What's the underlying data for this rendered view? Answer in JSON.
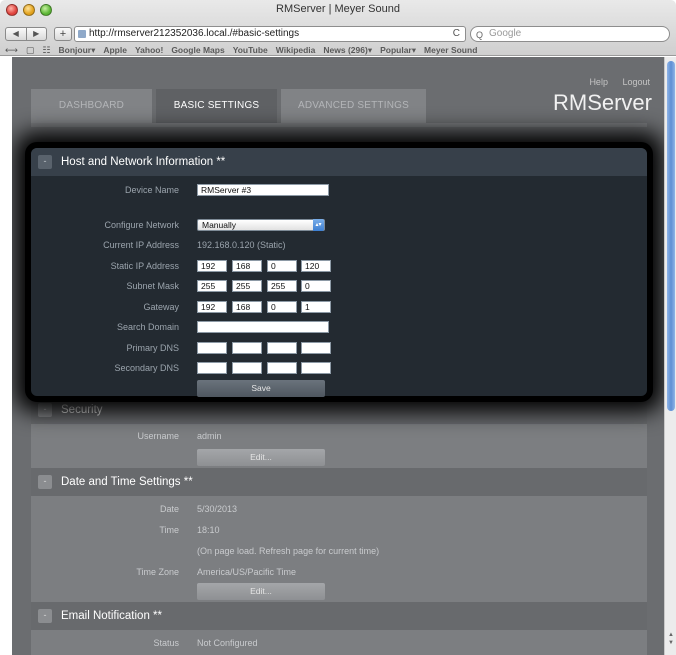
{
  "browser": {
    "window_title": "RMServer | Meyer Sound",
    "nav_back": "◀",
    "nav_forward": "▶",
    "add_label": "+",
    "url": "http://rmserver212352036.local./#basic-settings",
    "reload": "C",
    "search_placeholder": "Google",
    "bookmarks": [
      "Bonjour▾",
      "Apple",
      "Yahoo!",
      "Google Maps",
      "YouTube",
      "Wikipedia",
      "News (296)▾",
      "Popular▾",
      "Meyer Sound"
    ]
  },
  "header": {
    "help": "Help",
    "logout": "Logout",
    "brand": "RMServer"
  },
  "tabs": [
    "DASHBOARD",
    "BASIC SETTINGS",
    "ADVANCED SETTINGS"
  ],
  "network": {
    "title": "Host and Network Information **",
    "collapse": "-",
    "device_name_label": "Device Name",
    "device_name": "RMServer #3",
    "configure_label": "Configure Network",
    "configure_value": "Manually",
    "current_ip_label": "Current IP Address",
    "current_ip": "192.168.0.120 (Static)",
    "static_ip_label": "Static IP Address",
    "static_ip": [
      "192",
      "168",
      "0",
      "120"
    ],
    "subnet_label": "Subnet Mask",
    "subnet": [
      "255",
      "255",
      "255",
      "0"
    ],
    "gateway_label": "Gateway",
    "gateway": [
      "192",
      "168",
      "0",
      "1"
    ],
    "search_domain_label": "Search Domain",
    "search_domain": "",
    "primary_dns_label": "Primary DNS",
    "secondary_dns_label": "Secondary DNS",
    "save": "Save"
  },
  "security": {
    "title": "Security",
    "collapse": "-",
    "username_label": "Username",
    "username": "admin",
    "edit": "Edit..."
  },
  "datetime": {
    "title": "Date and Time Settings **",
    "collapse": "-",
    "date_label": "Date",
    "date": "5/30/2013",
    "time_label": "Time",
    "time": "18:10",
    "note": "(On page load. Refresh page for current time)",
    "tz_label": "Time Zone",
    "tz": "America/US/Pacific Time",
    "edit": "Edit..."
  },
  "email": {
    "title": "Email Notification **",
    "collapse": "-",
    "status_label": "Status",
    "status": "Not Configured"
  }
}
